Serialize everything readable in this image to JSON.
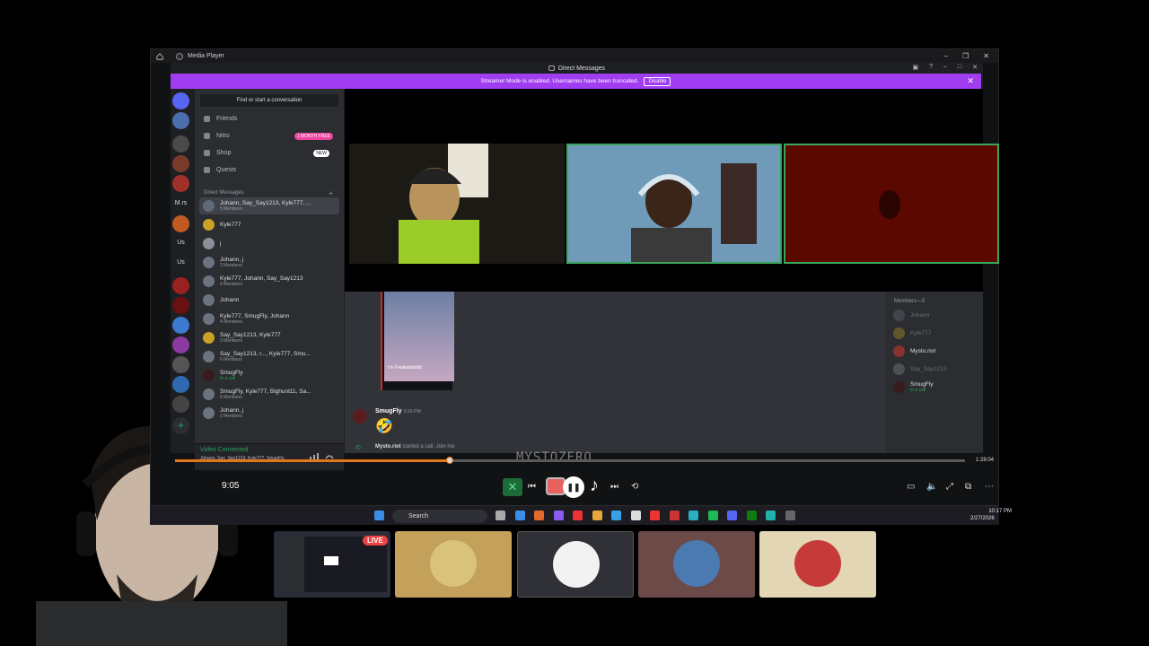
{
  "player": {
    "title": "Media Player",
    "elapsed": "9:05",
    "duration": "1:28:04",
    "progress_fraction": 0.348,
    "watermark": "MYSTOZERO"
  },
  "discord": {
    "window_title": "Direct Messages",
    "banner_text": "Streamer Mode is enabled. Usernames have been truncated.",
    "banner_button": "Disable",
    "find_placeholder": "Find or start a conversation",
    "nav": [
      {
        "label": "Friends",
        "badge": ""
      },
      {
        "label": "Nitro",
        "badge": "1 MONTH FREE"
      },
      {
        "label": "Shop",
        "badge": "NEW"
      },
      {
        "label": "Quests",
        "badge": ""
      }
    ],
    "dm_header": "Direct Messages",
    "dms": [
      {
        "name": "Johann, Say_Say1213, Kyle777, ...",
        "sub": "5 Members",
        "color": "#5d6b7a"
      },
      {
        "name": "Kyle777",
        "sub": "",
        "color": "#c9a227"
      },
      {
        "name": "j",
        "sub": "",
        "color": "#8a8f98"
      },
      {
        "name": "Johann, j",
        "sub": "3 Members",
        "color": "#6b7380"
      },
      {
        "name": "Kyle777, Johann, Say_Say1213",
        "sub": "4 Members",
        "color": "#6b7380"
      },
      {
        "name": "Johann",
        "sub": "",
        "color": "#6b7380"
      },
      {
        "name": "Kyle777, SmugFly, Johann",
        "sub": "4 Members",
        "color": "#6b7380"
      },
      {
        "name": "Say_Say1213, Kyle777",
        "sub": "3 Members",
        "color": "#c9a227"
      },
      {
        "name": "Say_Say1213, r..., Kyle777, Smu...",
        "sub": "6 Members",
        "color": "#6b7380"
      },
      {
        "name": "SmugFly",
        "sub": "In a call",
        "color": "#3a1b1b"
      },
      {
        "name": "SmugFly, Kyle777, Bighunt11, Sa...",
        "sub": "6 Members",
        "color": "#6b7380"
      },
      {
        "name": "Johann, j",
        "sub": "3 Members",
        "color": "#6b7380"
      }
    ],
    "voice": {
      "status": "Video Connected",
      "channel": "Johann, Say_Say1213, Kyle777, SmugFly"
    },
    "rail_texts": [
      "M.rs",
      "Us",
      "Us"
    ],
    "chat": {
      "thumb_caption": "I'm Freakidiekidd",
      "author": "SmugFly",
      "time": "5:16 PM",
      "emoji": "🤣",
      "system_user": "Mysto.riot",
      "system_text": "started a call. Join me"
    },
    "members": {
      "header": "Members—5",
      "list": [
        {
          "name": "Johann",
          "sub": "",
          "dim": true,
          "color": "#6b7380"
        },
        {
          "name": "Kyle777",
          "sub": "",
          "dim": true,
          "color": "#c9a227"
        },
        {
          "name": "Mysto.riot",
          "sub": "",
          "dim": false,
          "color": "#8a3030"
        },
        {
          "name": "Say_Say1213",
          "sub": "",
          "dim": true,
          "color": "#8a8f98"
        },
        {
          "name": "SmugFly",
          "sub": "In a call",
          "dim": false,
          "color": "#3a1b1b"
        }
      ]
    }
  },
  "taskbar": {
    "search": "Search",
    "time": "10:17 PM",
    "date": "2/27/2026"
  },
  "stream": {
    "live_label": "LIVE"
  },
  "colors": {
    "accent_orange": "#e3761b",
    "banner_purple": "#a13df0",
    "discord_green": "#23a55a"
  }
}
